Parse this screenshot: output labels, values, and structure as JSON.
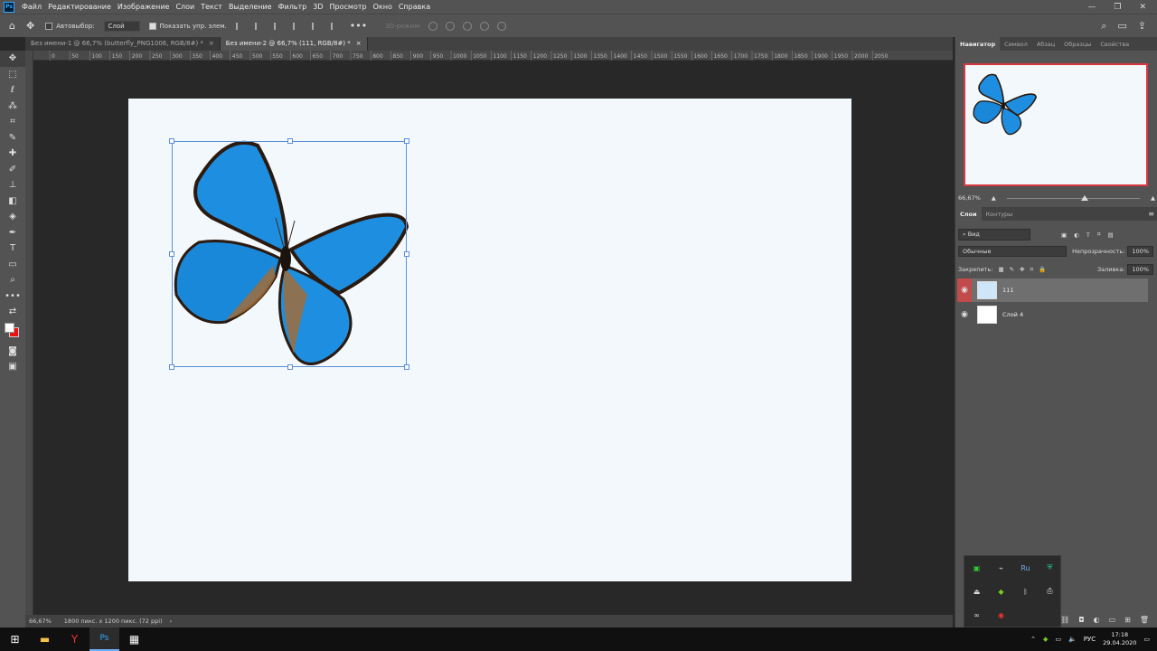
{
  "app": {
    "logo": "Ps"
  },
  "menu": [
    "Файл",
    "Редактирование",
    "Изображение",
    "Слои",
    "Текст",
    "Выделение",
    "Фильтр",
    "3D",
    "Просмотр",
    "Окно",
    "Справка"
  ],
  "window_controls": {
    "minimize": "—",
    "restore": "❐",
    "close": "✕"
  },
  "options": {
    "autoselect_label": "Автовыбор:",
    "autoselect_value": "Слой",
    "show_transform_label": "Показать упр. элем.",
    "mode3d_label": "3D-режим:"
  },
  "tabs": [
    {
      "label": "Без имени-1 @ 66,7% (butterfly_PNG1006, RGB/8#) *",
      "active": false
    },
    {
      "label": "Без имени-2 @ 66,7% (111, RGB/8#) *",
      "active": true
    }
  ],
  "tab_close": "×",
  "ruler_labels": [
    "0",
    "50",
    "100",
    "150",
    "200",
    "250",
    "300",
    "350",
    "400",
    "450",
    "500",
    "550",
    "600",
    "650",
    "700",
    "750",
    "800",
    "850",
    "900",
    "950",
    "1000",
    "1050",
    "1100",
    "1150",
    "1200",
    "1250",
    "1300",
    "1350",
    "1400",
    "1450",
    "1500",
    "1550",
    "1600",
    "1650",
    "1700",
    "1750",
    "1800",
    "1850",
    "1900",
    "1950",
    "2000",
    "2050"
  ],
  "status": {
    "zoom": "66,67%",
    "doc_info": "1800 пикс. x 1200 пикс. (72 ppi)",
    "arrow": "›"
  },
  "panels": {
    "top_tabs": [
      "Навигатор",
      "Символ",
      "Абзац",
      "Образцы",
      "Свойства"
    ],
    "nav_zoom": "66,67%",
    "nav_zoom_fraction": 0.56,
    "layer_tabs": [
      "Слои",
      "Контуры"
    ],
    "kind_filter": "Вид",
    "blend_mode": "Обычные",
    "opacity_label": "Непрозрачность:",
    "opacity_value": "100%",
    "lock_label": "Закрепить:",
    "fill_label": "Заливка:",
    "fill_value": "100%",
    "layers": [
      {
        "name": "111",
        "active": true
      },
      {
        "name": "Слой 4",
        "active": false
      }
    ]
  },
  "taskbar": {
    "lang": "РУС",
    "time": "17:18",
    "date": "29.04.2020"
  },
  "colors": {
    "butterfly_blue": "#1e8fe0",
    "selection": "#5b8fd8",
    "nav_border": "#d9373f"
  }
}
